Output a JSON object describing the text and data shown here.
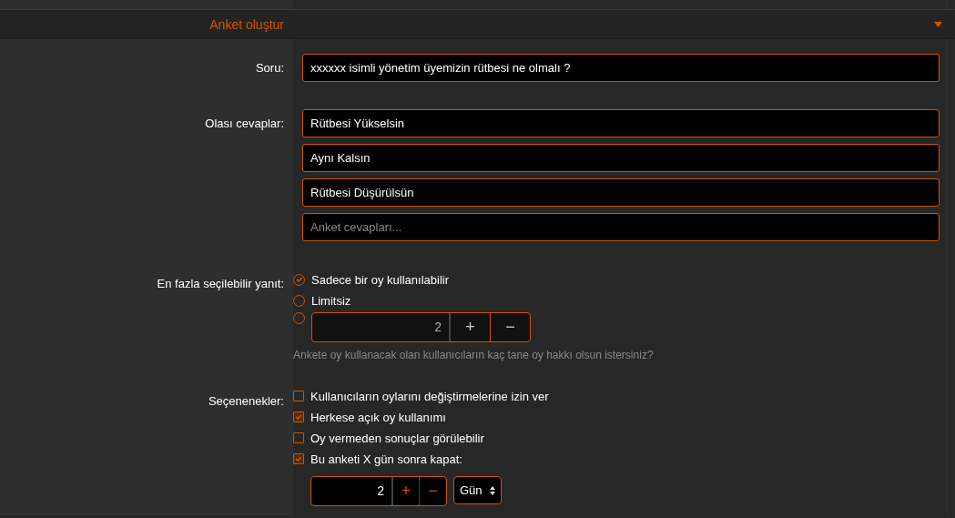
{
  "header": {
    "title": "Anket oluştur",
    "expanded": true
  },
  "question": {
    "label": "Soru:",
    "value": "xxxxxx isimli yönetim üyemizin rütbesi ne olmalı ?"
  },
  "answers": {
    "label": "Olası cevaplar:",
    "values": [
      "Rütbesi Yükselsin",
      "Aynı Kalsın",
      "Rütbesi Düşürülsün"
    ],
    "placeholder": "Anket cevapları..."
  },
  "max_choices": {
    "label": "En fazla seçilebilir yanıt:",
    "options": [
      {
        "kind": "text",
        "label": "Sadece bir oy kullanılabilir",
        "selected": true
      },
      {
        "kind": "text",
        "label": "Limitsiz",
        "selected": false
      },
      {
        "kind": "number",
        "value": "2",
        "plus": "+",
        "minus": "−",
        "selected": false
      }
    ],
    "hint": "Ankete oy kullanacak olan kullanıcıların kaç tane oy hakkı olsun istersiniz?"
  },
  "options": {
    "label": "Seçenenekler:",
    "items": [
      {
        "label": "Kullanıcıların oylarını değiştirmelerine izin ver",
        "checked": false
      },
      {
        "label": "Herkese açık oy kullanımı",
        "checked": true
      },
      {
        "label": "Oy vermeden sonuçlar görülebilir",
        "checked": false
      },
      {
        "label": "Bu anketi X gün sonra kapat:",
        "checked": true
      }
    ],
    "close_after": {
      "value": "2",
      "plus": "+",
      "minus": "−",
      "unit": "Gün"
    }
  }
}
